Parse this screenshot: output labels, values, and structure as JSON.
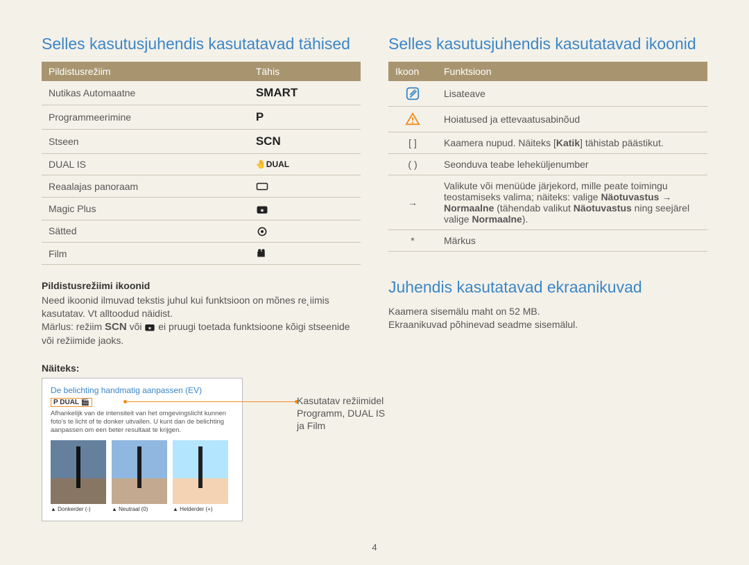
{
  "left": {
    "heading": "Selles kasutusjuhendis kasutatavad tähised",
    "table_head": {
      "col1": "Pildistusrežiim",
      "col2": "Tähis"
    },
    "rows": [
      {
        "mode": "Nutikas Automaatne",
        "sym": "SMART"
      },
      {
        "mode": "Programmeerimine",
        "sym": "P"
      },
      {
        "mode": "Stseen",
        "sym": "SCN"
      },
      {
        "mode": "DUAL IS",
        "sym": "DUAL"
      },
      {
        "mode": "Reaalajas panoraam",
        "sym": "pano"
      },
      {
        "mode": "Magic Plus",
        "sym": "star"
      },
      {
        "mode": "Sätted",
        "sym": "gear"
      },
      {
        "mode": "Film",
        "sym": "film"
      }
    ],
    "sub1": "Pildistusrežiimi ikoonid",
    "text1": "Need ikoonid ilmuvad tekstis juhul kui funktsioon on mõnes re˛iimis kasutatav. Vt alltoodud näidist.",
    "text2a": "Märlus: režiim ",
    "text2b": " või ",
    "text2c": " ei pruugi toetada funktsioone kõigi stseenide või režiimide jaoks.",
    "sub2": "Näiteks:",
    "example": {
      "title": "De belichting handmatig aanpassen (EV)",
      "chip": "P  DUAL  🎬",
      "desc": "Afhankelijk van de intensiteit van het omgevingslicht kunnen foto's te licht of te donker uitvallen. U kunt dan de belichting aanpassen om een beter resultaat te krijgen.",
      "caps": [
        "▲ Donkerder (-)",
        "▲ Neutraal (0)",
        "▲ Helderder (+)"
      ]
    },
    "callout": "Kasutatav režiimidel Programm, DUAL IS ja Film"
  },
  "right": {
    "heading1": "Selles kasutusjuhendis kasutatavad ikoonid",
    "table_head": {
      "col1": "Ikoon",
      "col2": "Funktsioon"
    },
    "rows": [
      {
        "icon": "info",
        "func": "Lisateave"
      },
      {
        "icon": "warn",
        "func": "Hoiatused ja ettevaatusabinõud"
      },
      {
        "icon": "[ ]",
        "func_html": "Kaamera nupud. Näiteks [<b>Katik</b>] tähistab päästikut."
      },
      {
        "icon": "( )",
        "func": "Seonduva teabe leheküljenumber"
      },
      {
        "icon": "→",
        "func_html": "Valikute või menüüde järjekord, mille peate toimingu teostamiseks valima; näiteks: valige <b>Näotuvastus</b> → <b>Normaalne</b> (tähendab valikut <b>Näotuvastus</b> ning seejärel valige <b>Normaalne</b>)."
      },
      {
        "icon": "*",
        "func": "Märkus"
      }
    ],
    "heading2": "Juhendis kasutatavad ekraanikuvad",
    "text1": "Kaamera sisemälu maht on 52 MB.",
    "text2": "Ekraanikuvad põhinevad seadme sisemälul."
  },
  "page_number": "4"
}
